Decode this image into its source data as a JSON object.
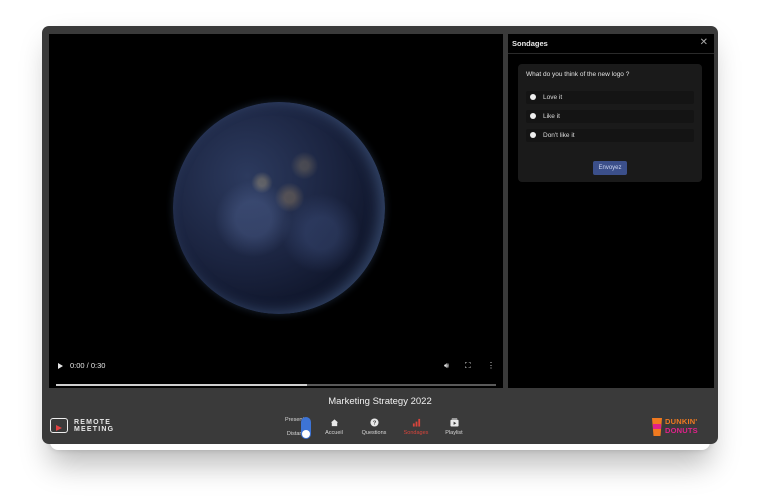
{
  "video": {
    "time": "0:00 / 0:30",
    "progress": 0.57,
    "controls": [
      "play-icon",
      "volume-icon",
      "fullscreen-icon",
      "more-options-icon"
    ]
  },
  "panel": {
    "title": "Sondages",
    "close_icon": "close-icon",
    "poll": {
      "question": "What do you think of the new logo ?",
      "options": [
        "Love it",
        "Like it",
        "Don't like it"
      ],
      "submit_label": "Envoyez"
    }
  },
  "footer": {
    "meeting_title": "Marketing Strategy 2022",
    "logo": {
      "line1": "REMOTE",
      "line2": "MEETING"
    },
    "toggle": {
      "top_label": "Present",
      "bottom_label": "Distant",
      "accent": "#3d74d6"
    },
    "nav": [
      {
        "label": "Accueil",
        "icon": "home-icon",
        "active": false
      },
      {
        "label": "Questions",
        "icon": "question-icon",
        "active": false
      },
      {
        "label": "Sondages",
        "icon": "bar-chart-icon",
        "active": true
      },
      {
        "label": "Playlist",
        "icon": "playlist-icon",
        "active": false
      }
    ],
    "brand": {
      "line1": "DUNKIN'",
      "line2": "DONUTS"
    }
  },
  "colors": {
    "active": "#d8453c",
    "button": "#3b4f8a",
    "window": "#3a3a3a"
  }
}
